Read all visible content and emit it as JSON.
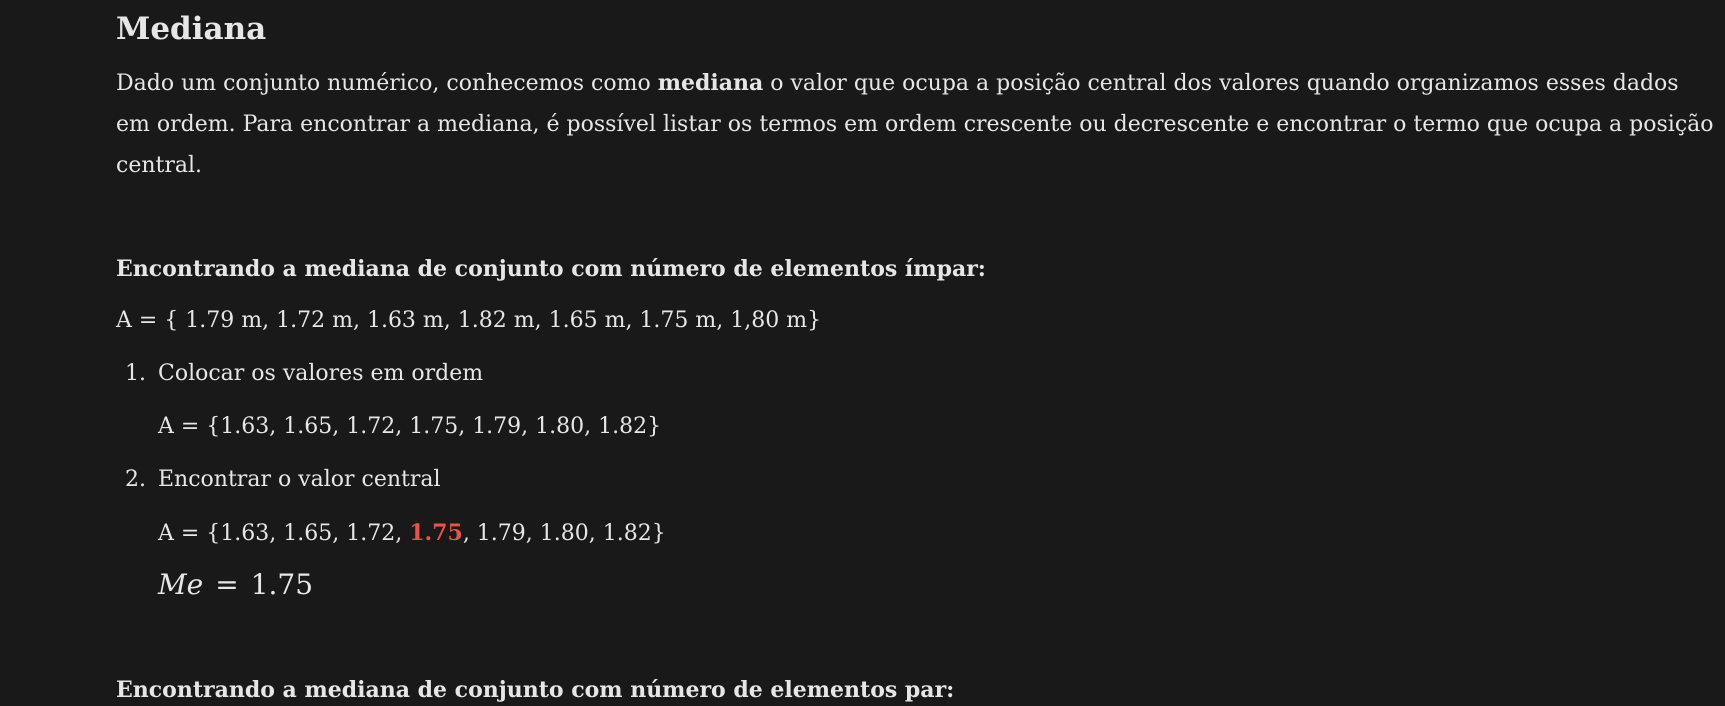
{
  "title": "Mediana",
  "intro": {
    "line1_before": "Dado um conjunto numérico, conhecemos como ",
    "line1_bold": "mediana",
    "line1_after": " o valor que ocupa a posição central dos valores quando organizamos esses dados",
    "line2": "em ordem. Para encontrar a mediana, é possível listar os termos em ordem crescente ou decrescente e encontrar o termo que ocupa a posição",
    "line3": "central."
  },
  "odd_section": {
    "heading": "Encontrando a mediana de conjunto com número de elementos ímpar:",
    "set": "A = { 1.79 m, 1.72 m, 1.63 m, 1.82 m, 1.65 m, 1.75 m, 1,80 m}",
    "steps": [
      {
        "number": "1.",
        "text": "Colocar os valores em ordem",
        "detail": "A = {1.63, 1.65, 1.72, 1.75, 1.79, 1.80, 1.82}"
      },
      {
        "number": "2.",
        "text": "Encontrar o valor central",
        "detail_before": "A = {1.63, 1.65, 1.72, ",
        "detail_highlight": "1.75",
        "detail_after": ", 1.79, 1.80, 1.82}"
      }
    ],
    "formula": {
      "variable": "Me",
      "operator": "=",
      "value": "1.75"
    }
  },
  "even_section": {
    "heading": "Encontrando a mediana de conjunto com número de elementos par:"
  },
  "colors": {
    "background": "#191919",
    "text": "#e6e6e6",
    "highlight": "#e5534b"
  }
}
